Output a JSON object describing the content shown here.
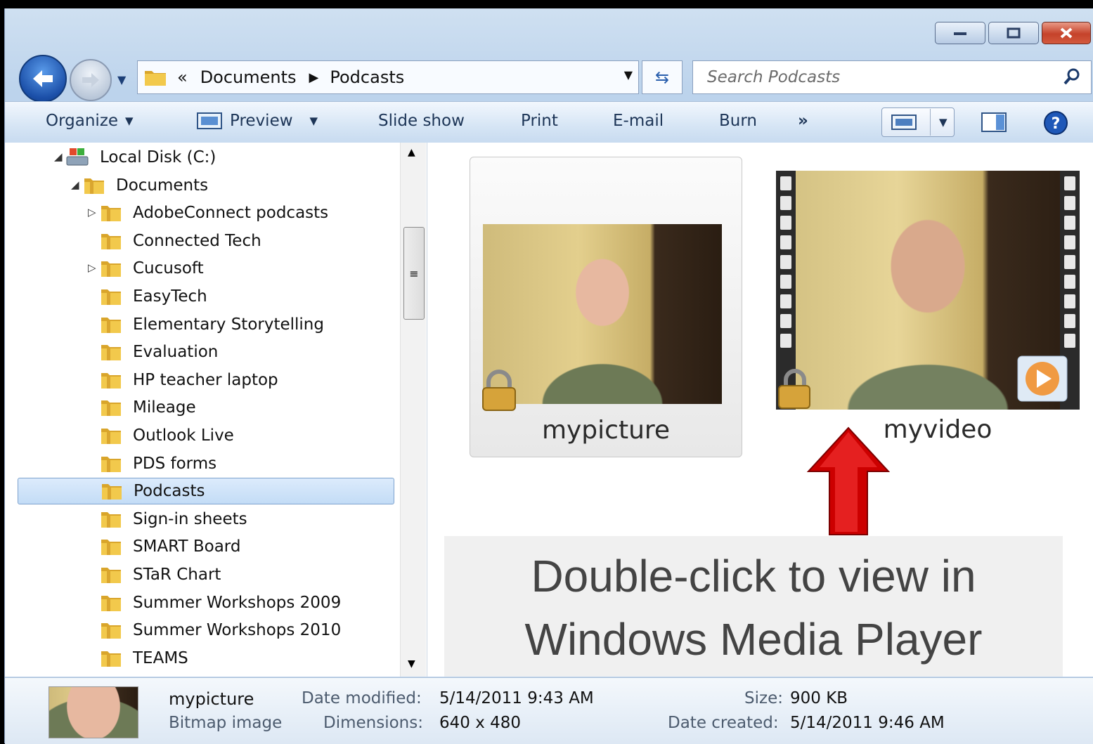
{
  "address": {
    "overflow": "«",
    "crumbs": [
      "Documents",
      "Podcasts"
    ]
  },
  "search": {
    "placeholder": "Search Podcasts"
  },
  "toolbar": {
    "organize": "Organize",
    "preview": "Preview",
    "slideshow": "Slide show",
    "print": "Print",
    "email": "E-mail",
    "burn": "Burn",
    "more": "»"
  },
  "tree": {
    "drive": "Local Disk (C:)",
    "documents": "Documents",
    "folders": [
      "AdobeConnect podcasts",
      "Connected Tech",
      "Cucusoft",
      "EasyTech",
      "Elementary Storytelling",
      "Evaluation",
      "HP teacher laptop",
      "Mileage",
      "Outlook Live",
      "PDS forms",
      "Podcasts",
      "Sign-in sheets",
      "SMART Board",
      "STaR Chart",
      "Summer Workshops 2009",
      "Summer Workshops 2010",
      "TEAMS"
    ]
  },
  "files": [
    {
      "name": "mypicture"
    },
    {
      "name": "myvideo"
    }
  ],
  "callout": {
    "line1": "Double-click to view in",
    "line2": "Windows Media Player"
  },
  "details": {
    "name": "mypicture",
    "type": "Bitmap image",
    "modified_label": "Date modified:",
    "modified_value": "5/14/2011 9:43 AM",
    "dimensions_label": "Dimensions:",
    "dimensions_value": "640 x 480",
    "size_label": "Size:",
    "size_value": "900 KB",
    "created_label": "Date created:",
    "created_value": "5/14/2011 9:46 AM"
  },
  "colors": {
    "accent_arrow": "#cc0000",
    "folder": "#e8b83a",
    "selection": "#c3dcf6"
  }
}
